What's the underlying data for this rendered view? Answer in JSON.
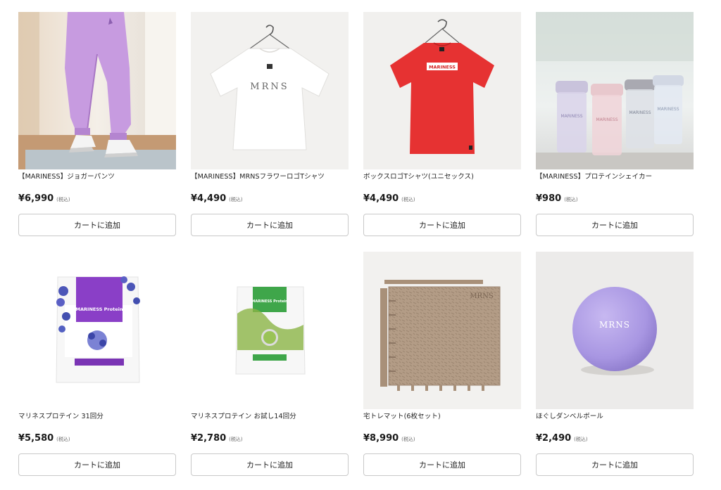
{
  "products": [
    {
      "name": "【MARINESS】ジョガーパンツ",
      "price": "¥6,990",
      "tax": "(税込)",
      "button": "カートに追加",
      "image": "purple-jogger-pants-photo"
    },
    {
      "name": "【MARINESS】MRNSフラワーロゴTシャツ",
      "price": "¥4,490",
      "tax": "(税込)",
      "button": "カートに追加",
      "image": "white-tshirt-photo",
      "image_text": "MRNS"
    },
    {
      "name": "ボックスロゴTシャツ(ユニセックス)",
      "price": "¥4,490",
      "tax": "(税込)",
      "button": "カートに追加",
      "image": "red-tshirt-photo",
      "image_text": "MARINESS"
    },
    {
      "name": "【MARINESS】プロテインシェイカー",
      "price": "¥980",
      "tax": "(税込)",
      "button": "カートに追加",
      "image": "protein-shakers-photo",
      "image_text": "MARINESS"
    },
    {
      "name": "マリネスプロテイン 31回分",
      "price": "¥5,580",
      "tax": "(税込)",
      "button": "カートに追加",
      "image": "blueberry-protein-pouch-photo",
      "image_text": "MARINESS Protein"
    },
    {
      "name": "マリネスプロテイン お試し14回分",
      "price": "¥2,780",
      "tax": "(税込)",
      "button": "カートに追加",
      "image": "matcha-protein-pouch-photo",
      "image_text": "MARINESS Protein"
    },
    {
      "name": "宅トレマット(6枚セット)",
      "price": "¥8,990",
      "tax": "(税込)",
      "button": "カートに追加",
      "image": "training-mat-photo",
      "image_text": "MRNS"
    },
    {
      "name": "ほぐしダンベルボール",
      "price": "¥2,490",
      "tax": "(税込)",
      "button": "カートに追加",
      "image": "lavender-massage-ball-photo",
      "image_text": "MRNS"
    }
  ],
  "colors": {
    "button_border": "#c9c9c9",
    "text": "#1a1a1a",
    "tax_text": "#666666"
  }
}
